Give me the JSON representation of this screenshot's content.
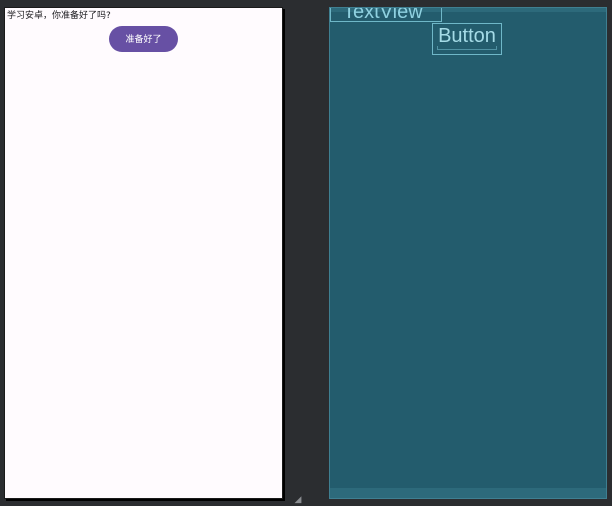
{
  "design": {
    "textview_text": "学习安卓，你准备好了吗?",
    "button_label": "准备好了"
  },
  "blueprint": {
    "textview_label": "TextView",
    "button_label": "Button"
  },
  "colors": {
    "canvas_background": "#2b2d30",
    "design_background": "#fffbfe",
    "button_fill": "#6750a4",
    "button_text": "#ffffff",
    "blueprint_background": "#235c6d",
    "blueprint_outline": "#6fb7c8"
  },
  "icons": {
    "resize_handle": "resize-handle-icon"
  }
}
